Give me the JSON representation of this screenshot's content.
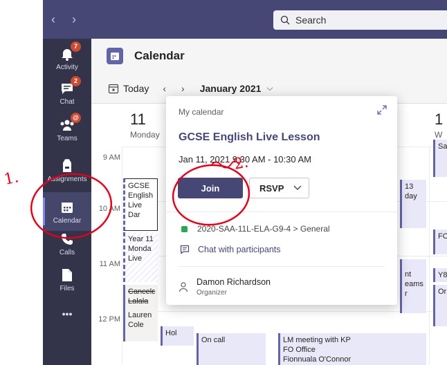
{
  "topbar": {
    "back": "‹",
    "forward": "›",
    "search_label": "Search"
  },
  "rail": {
    "items": [
      {
        "label": "Activity",
        "badge": "7"
      },
      {
        "label": "Chat",
        "badge": "2"
      },
      {
        "label": "Teams",
        "badge": "@"
      },
      {
        "label": "Assignments",
        "badge": ""
      },
      {
        "label": "Calendar",
        "badge": ""
      },
      {
        "label": "Calls",
        "badge": ""
      },
      {
        "label": "Files",
        "badge": ""
      },
      {
        "label": "•••",
        "badge": ""
      }
    ]
  },
  "header": {
    "title": "Calendar"
  },
  "toolbar": {
    "today": "Today",
    "prev": "‹",
    "next": "›",
    "month": "January 2021",
    "month_chev": "⌵"
  },
  "grid": {
    "days": [
      {
        "num": "11",
        "name": "Monday"
      },
      {
        "num": "1",
        "name": "W"
      }
    ],
    "times": [
      "9 AM",
      "10 AM",
      "11 AM",
      "12 PM"
    ]
  },
  "events": {
    "gcse": [
      "GCSE",
      "English",
      "Live",
      "Dar"
    ],
    "year11": [
      "Year 11",
      "Monda",
      "Live"
    ],
    "cancel": [
      "Cancelε",
      "Lalala",
      "Lauren",
      "Cole"
    ],
    "hol": "Hol",
    "oncall": "On call",
    "lm": [
      "LM meeting with KP",
      "FO Office",
      "Fionnuala O'Connor"
    ],
    "right13": [
      "13",
      "day"
    ],
    "nt": [
      "nt",
      "eams",
      "r"
    ],
    "far_right": [
      "Sa",
      "FO",
      "Y8",
      "Or"
    ]
  },
  "popup": {
    "source": "My calendar",
    "title": "GCSE English Live Lesson",
    "time": "Jan 11, 2021 9:30 AM - 10:30 AM",
    "join": "Join",
    "rsvp": "RSVP",
    "channel": "2020-SAA-11L-ELA-G9-4 > General",
    "chat": "Chat with participants",
    "organizer_name": "Damon Richardson",
    "organizer_role": "Organizer"
  },
  "annotations": {
    "one": "1.",
    "two": "2."
  },
  "colors": {
    "brand": "#464775",
    "accent": "#6264a7",
    "rail": "#33344a",
    "annotation": "#e0001b"
  }
}
